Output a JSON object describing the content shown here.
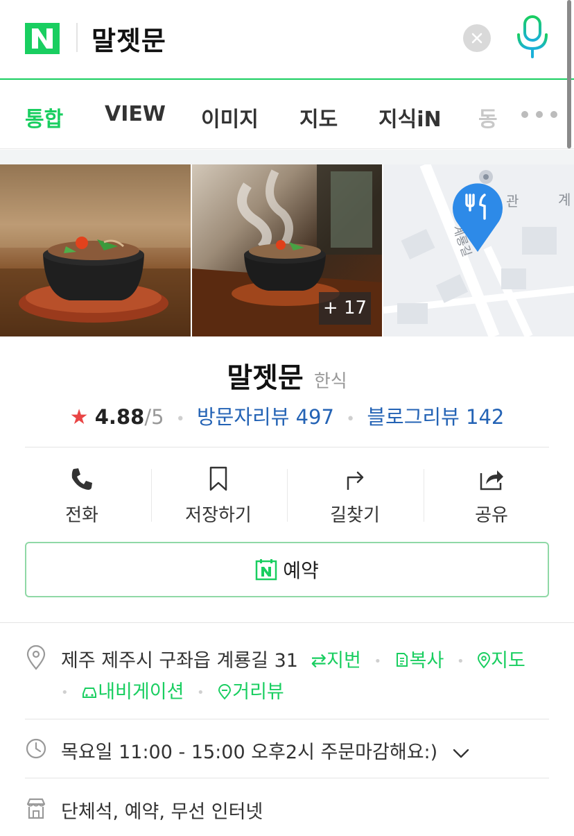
{
  "search": {
    "query": "말젯문"
  },
  "tabs": [
    {
      "label": "통합",
      "active": true
    },
    {
      "label": "VIEW"
    },
    {
      "label": "이미지"
    },
    {
      "label": "지도"
    },
    {
      "label": "지식iN"
    },
    {
      "label": "동"
    }
  ],
  "images": {
    "more_count": "+ 17",
    "map_labels": [
      "계룡길",
      "관",
      "계"
    ]
  },
  "place": {
    "name": "말젯문",
    "category": "한식",
    "rating": "4.88",
    "rating_max": "/5",
    "visitor_review": "방문자리뷰 497",
    "blog_review": "블로그리뷰 142"
  },
  "actions": {
    "call": "전화",
    "save": "저장하기",
    "directions": "길찾기",
    "share": "공유"
  },
  "reserve": {
    "label": "예약"
  },
  "address": {
    "text": "제주 제주시 구좌읍 계룡길 31",
    "jibun": "지번",
    "copy": "복사",
    "map": "지도",
    "navigation": "내비게이션",
    "streetview": "거리뷰"
  },
  "hours": {
    "text": "목요일 11:00 - 15:00 오후2시 주문마감해요:)"
  },
  "facilities": {
    "text": "단체석, 예약, 무선 인터넷"
  },
  "colors": {
    "brand_green": "#19ce60",
    "link_blue": "#2463b5",
    "star_red": "#e94545",
    "map_pin_blue": "#2d8ae8"
  }
}
